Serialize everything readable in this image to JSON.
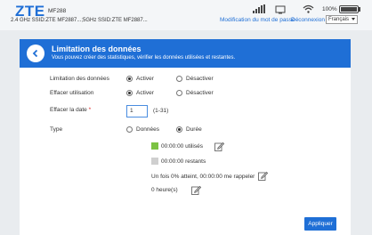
{
  "header": {
    "brand": "ZTE",
    "model": "MF288",
    "ssid_text": "2.4 GHz SSID:ZTE MF2887...;5GHz SSID:ZTE MF2887...",
    "battery": "100%",
    "change_password": "Modification du mot de passe",
    "logout": "Déconnexion",
    "language": "Français"
  },
  "panel": {
    "title": "Limitation des données",
    "subtitle": "Vous pouvez créer des statistiques, vérifier les données utilisées et restantes."
  },
  "form": {
    "limit_label": "Limitation des données",
    "limit_on": "Activer",
    "limit_off": "Désactiver",
    "clear_label": "Effacer utilisation",
    "clear_on": "Activer",
    "clear_off": "Désactiver",
    "date_label": "Effacer la date",
    "date_required": "*",
    "date_value": "1",
    "date_range": "(1-31)",
    "type_label": "Type",
    "type_data": "Données",
    "type_duration": "Durée",
    "used": "00:00:00 utilisés",
    "remaining": "00:00:00 restants",
    "reminder": "Un fois 0% atteint, 00:00:00 me rappeler",
    "hours": "0 heure(s)",
    "apply": "Appliquer"
  },
  "colors": {
    "accent": "#1f6fd6",
    "used": "#7cc243",
    "remaining": "#cfcfcf"
  }
}
